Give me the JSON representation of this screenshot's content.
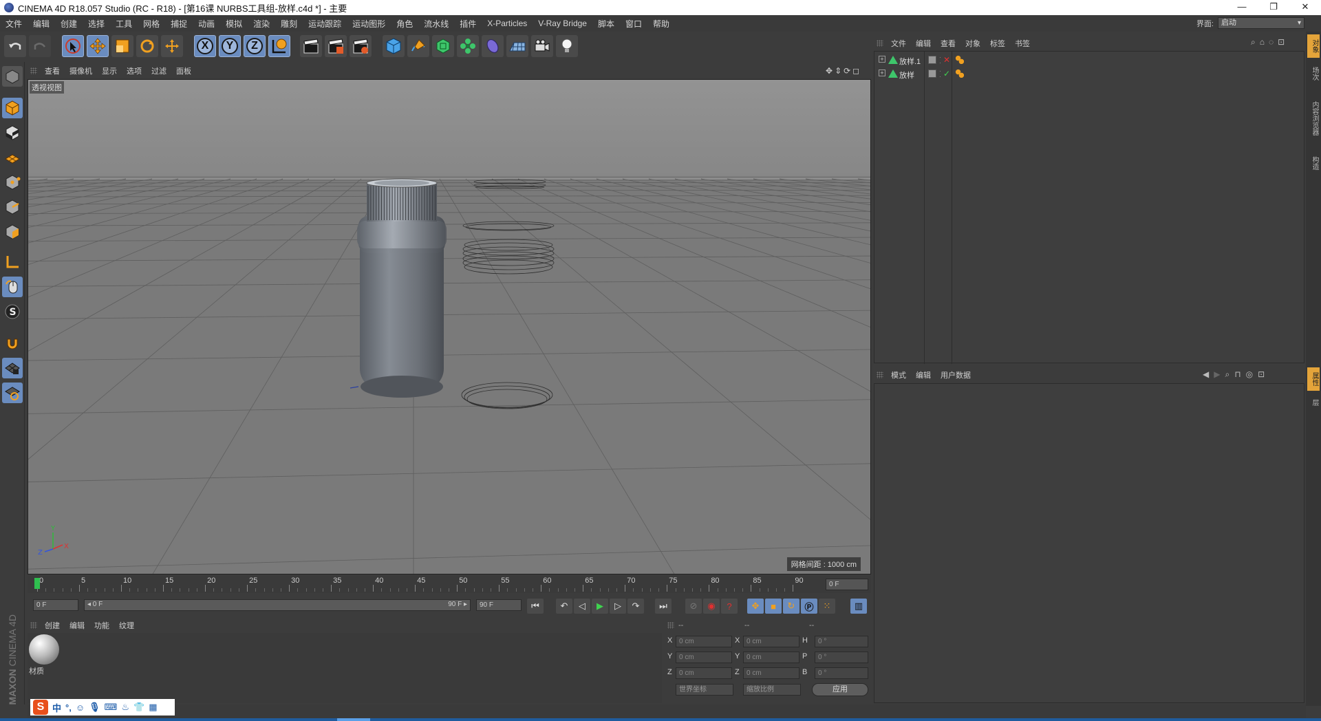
{
  "window": {
    "title": "CINEMA 4D R18.057 Studio (RC - R18) - [第16课  NURBS工具组-放样.c4d *] - 主要",
    "controls": [
      "—",
      "❐",
      "✕"
    ]
  },
  "menu": {
    "items": [
      "文件",
      "编辑",
      "创建",
      "选择",
      "工具",
      "网格",
      "捕捉",
      "动画",
      "模拟",
      "渲染",
      "雕刻",
      "运动跟踪",
      "运动图形",
      "角色",
      "流水线",
      "插件",
      "X-Particles",
      "V-Ray Bridge",
      "脚本",
      "窗口",
      "帮助"
    ],
    "layout_label": "界面:",
    "layout_value": "启动"
  },
  "toolbar": {
    "axis_x": "X",
    "axis_y": "Y",
    "axis_z": "Z"
  },
  "viewport": {
    "menu": [
      "查看",
      "摄像机",
      "显示",
      "选项",
      "过滤",
      "面板"
    ],
    "view_label": "透视视图",
    "grid_spacing": "网格间距 : 1000 cm",
    "axis_labels": {
      "x": "X",
      "y": "Y",
      "z": "Z"
    }
  },
  "timeline": {
    "ticks": [
      "0",
      "5",
      "10",
      "15",
      "20",
      "25",
      "30",
      "35",
      "40",
      "45",
      "50",
      "55",
      "60",
      "65",
      "70",
      "75",
      "80",
      "85",
      "90"
    ],
    "current_frame": "0 F",
    "start_field": "0 F",
    "range_start": "◂ 0 F",
    "range_end": "90 F ▸",
    "end_field": "90 F"
  },
  "material_manager": {
    "menu": [
      "创建",
      "编辑",
      "功能",
      "纹理"
    ],
    "materials": [
      {
        "name": "材质"
      }
    ]
  },
  "coordinates": {
    "headers": [
      "--",
      "--",
      "--"
    ],
    "rows": [
      {
        "a": "X",
        "a_val": "0 cm",
        "b": "X",
        "b_val": "0 cm",
        "c": "H",
        "c_val": "0 °"
      },
      {
        "a": "Y",
        "a_val": "0 cm",
        "b": "Y",
        "b_val": "0 cm",
        "c": "P",
        "c_val": "0 °"
      },
      {
        "a": "Z",
        "a_val": "0 cm",
        "b": "Z",
        "b_val": "0 cm",
        "c": "B",
        "c_val": "0 °"
      }
    ],
    "mode_world": "世界坐标",
    "mode_scale": "缩放比例",
    "apply": "应用"
  },
  "object_manager": {
    "menu": [
      "文件",
      "编辑",
      "查看",
      "对象",
      "标签",
      "书签"
    ],
    "objects": [
      {
        "name": "放样.1"
      },
      {
        "name": "放样"
      }
    ]
  },
  "attribute_manager": {
    "menu": [
      "模式",
      "编辑",
      "用户数据"
    ]
  },
  "right_tabs": [
    "对象",
    "场次",
    "内容浏览器",
    "构造",
    "属性",
    "层"
  ],
  "brand": {
    "maxon": "MAXON",
    "c4d": "CINEMA 4D"
  },
  "ime": {
    "lang": "中",
    "punct": "°,"
  },
  "colors": {
    "accent": "#6a8cbf",
    "tab_active": "#e4a43a",
    "bg": "#3c3c3c"
  }
}
